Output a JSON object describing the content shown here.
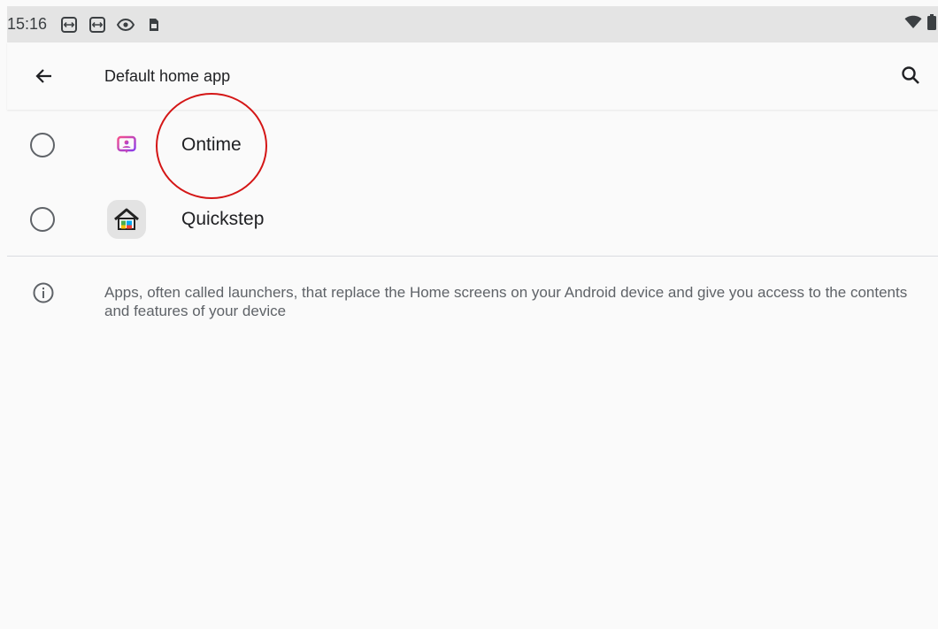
{
  "status_bar": {
    "time": "15:16",
    "left_icons": [
      "teamviewer-icon",
      "teamviewer-icon",
      "eye-icon",
      "sim-card-icon"
    ],
    "right_icons": [
      "wifi-icon",
      "battery-icon"
    ]
  },
  "app_bar": {
    "title": "Default home app",
    "back_icon": "arrow-back-icon",
    "search_icon": "search-icon"
  },
  "apps": [
    {
      "label": "Ontime",
      "icon": "ontime-app-icon",
      "selected": false
    },
    {
      "label": "Quickstep",
      "icon": "quickstep-app-icon",
      "selected": false
    }
  ],
  "info": {
    "icon": "info-icon",
    "text": "Apps, often called launchers, that replace the Home screens on your Android device and give you access to the contents and features of your device"
  },
  "colors": {
    "background": "#fafafa",
    "status_bar": "#e4e4e4",
    "annotation_circle": "#d41616",
    "ontime_gradient_start": "#f54e8c",
    "ontime_gradient_end": "#8b3dea"
  }
}
